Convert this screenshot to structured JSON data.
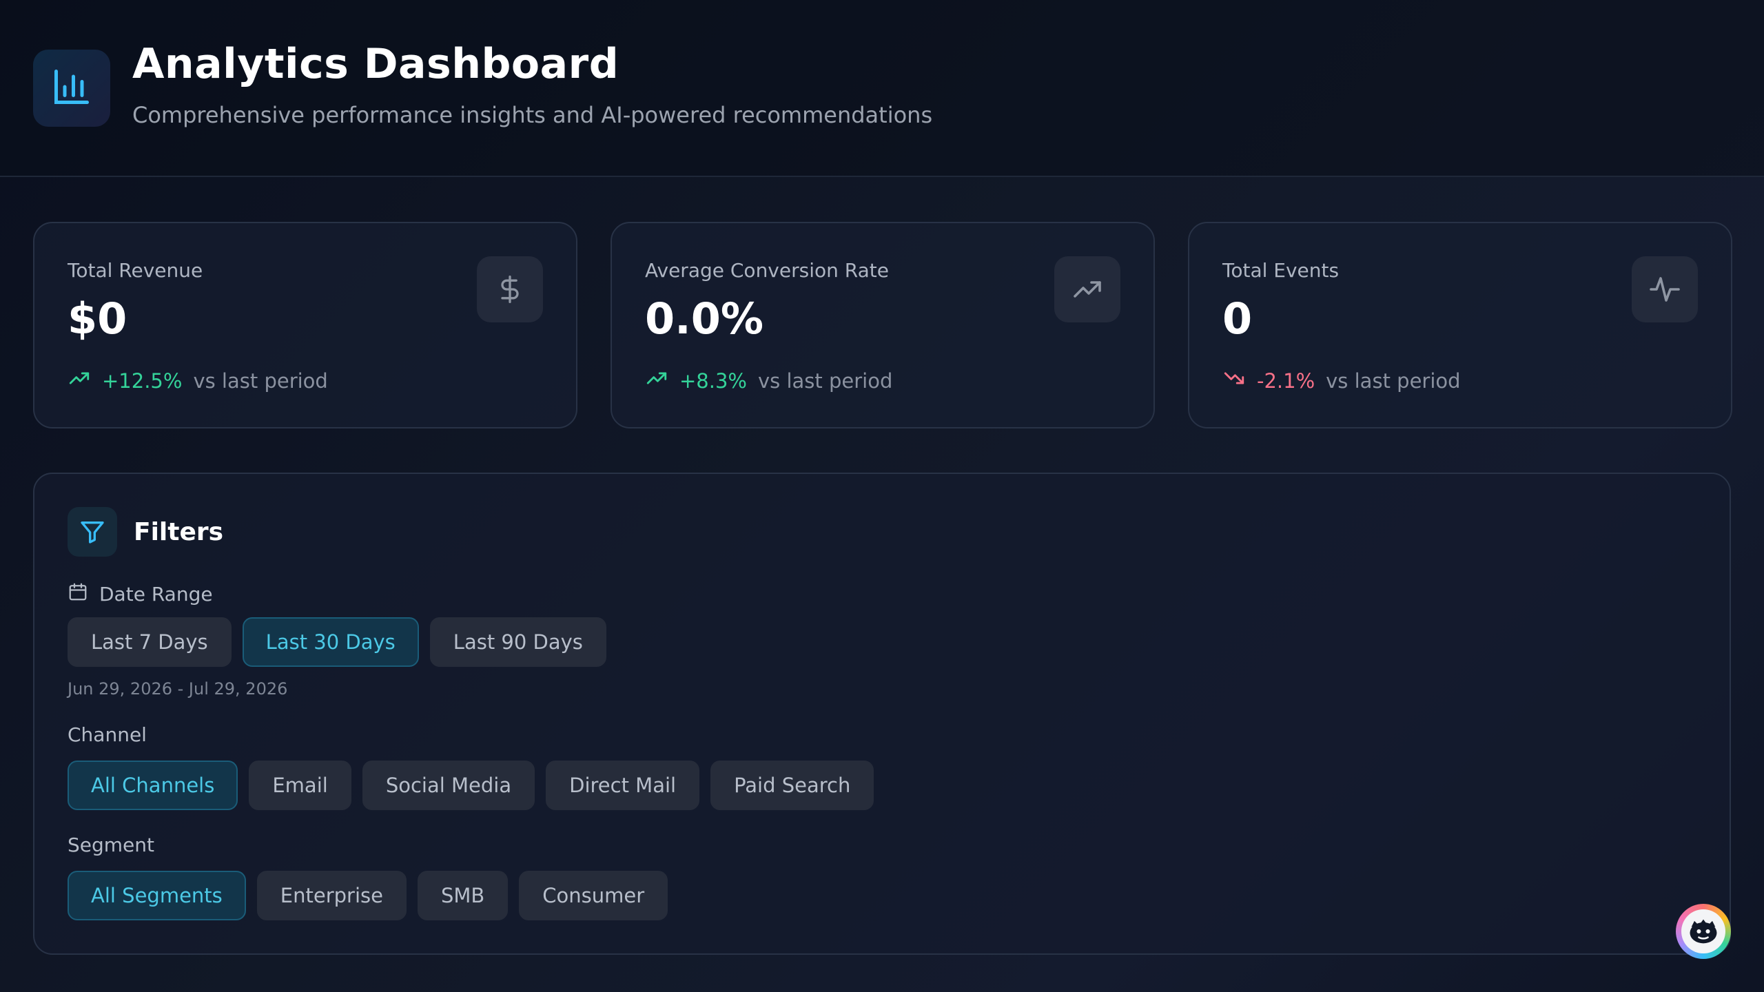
{
  "header": {
    "title": "Analytics Dashboard",
    "subtitle": "Comprehensive performance insights and AI-powered recommendations",
    "logo_icon": "bar-chart-icon"
  },
  "kpis": [
    {
      "label": "Total Revenue",
      "value": "$0",
      "icon": "dollar-icon",
      "trend": "+12.5%",
      "trend_direction": "up",
      "trend_suffix": "vs last period"
    },
    {
      "label": "Average Conversion Rate",
      "value": "0.0%",
      "icon": "trending-up-icon",
      "trend": "+8.3%",
      "trend_direction": "up",
      "trend_suffix": "vs last period"
    },
    {
      "label": "Total Events",
      "value": "0",
      "icon": "activity-icon",
      "trend": "-2.1%",
      "trend_direction": "down",
      "trend_suffix": "vs last period"
    }
  ],
  "filters": {
    "title": "Filters",
    "date_range": {
      "label": "Date Range",
      "options": [
        "Last 7 Days",
        "Last 30 Days",
        "Last 90 Days"
      ],
      "selected": "Last 30 Days",
      "range_text": "Jun 29, 2026 - Jul 29, 2026"
    },
    "channel": {
      "label": "Channel",
      "options": [
        "All Channels",
        "Email",
        "Social Media",
        "Direct Mail",
        "Paid Search"
      ],
      "selected": "All Channels"
    },
    "segment": {
      "label": "Segment",
      "options": [
        "All Segments",
        "Enterprise",
        "SMB",
        "Consumer"
      ],
      "selected": "All Segments"
    }
  },
  "colors": {
    "accent": "#4cc9e6",
    "positive": "#34d399",
    "negative": "#f87188",
    "background": "#0f1524"
  }
}
